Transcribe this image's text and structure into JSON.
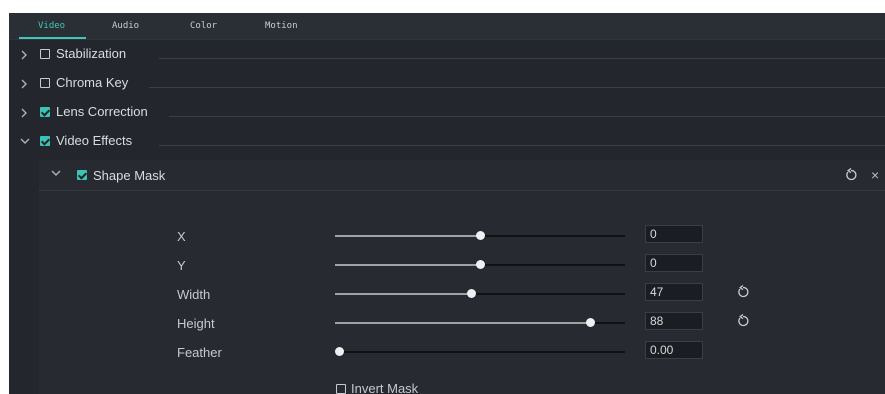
{
  "tabs": [
    {
      "label": "Video",
      "active": true
    },
    {
      "label": "Audio",
      "active": false
    },
    {
      "label": "Color",
      "active": false
    },
    {
      "label": "Motion",
      "active": false
    }
  ],
  "sections": [
    {
      "label": "Stabilization",
      "checked": false,
      "expanded": false
    },
    {
      "label": "Chroma Key",
      "checked": false,
      "expanded": false
    },
    {
      "label": "Lens Correction",
      "checked": true,
      "expanded": false
    },
    {
      "label": "Video Effects",
      "checked": true,
      "expanded": true
    }
  ],
  "shape_mask": {
    "label": "Shape Mask",
    "checked": true,
    "reset_icon": "reset-icon",
    "close_icon": "close-icon",
    "params": [
      {
        "label": "X",
        "value": "0",
        "level": 0.5,
        "resettable": false
      },
      {
        "label": "Y",
        "value": "0",
        "level": 0.5,
        "resettable": false
      },
      {
        "label": "Width",
        "value": "47",
        "level": 0.47,
        "resettable": true
      },
      {
        "label": "Height",
        "value": "88",
        "level": 0.88,
        "resettable": true
      },
      {
        "label": "Feather",
        "value": "0.00",
        "level": 0.0,
        "resettable": false
      }
    ],
    "invert_mask": {
      "label": "Invert Mask",
      "checked": false
    }
  },
  "colors": {
    "accent": "#40c6b6",
    "panel": "#23272d"
  }
}
